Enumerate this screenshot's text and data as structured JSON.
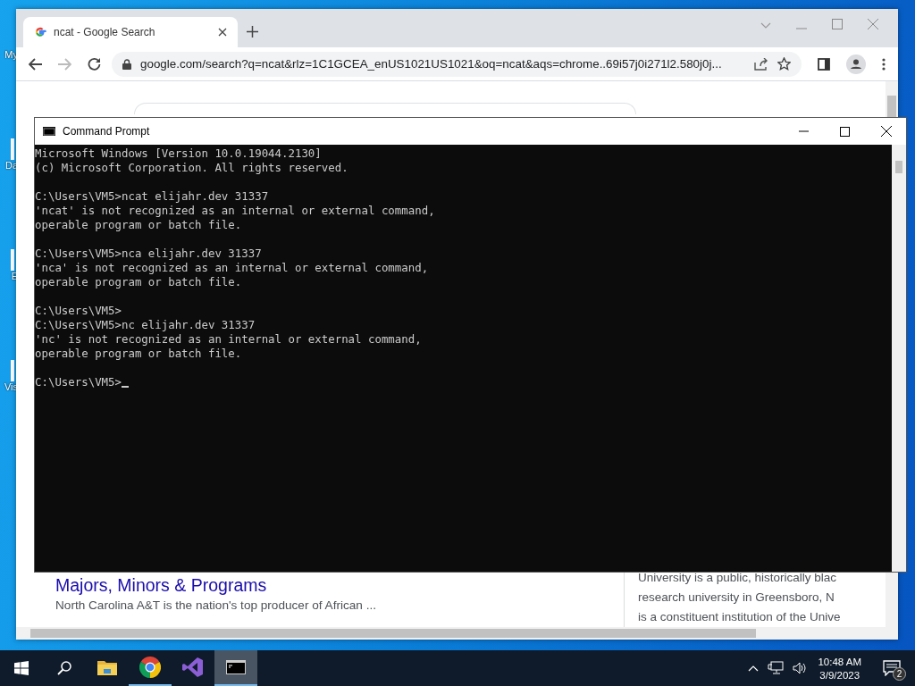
{
  "desktop": {
    "icons": [
      {
        "label": "My"
      },
      {
        "label": "Da"
      },
      {
        "label": "E"
      },
      {
        "label": "Vis"
      }
    ]
  },
  "browser": {
    "tab_title": "ncat - Google Search",
    "url": "google.com/search?q=ncat&rlz=1C1GCEA_enUS1021US1021&oq=ncat&aqs=chrome..69i57j0i271l2.580j0j...",
    "result": {
      "title": "Majors, Minors & Programs",
      "snippet": "North Carolina A&T is the nation's top producer of African ..."
    },
    "panel_lines": [
      "University is a public, historically blac",
      "research university in Greensboro, N",
      "is a constituent institution of the Unive"
    ]
  },
  "terminal": {
    "title": "Command Prompt",
    "blocks": [
      [
        "Microsoft Windows [Version 10.0.19044.2130]",
        "(c) Microsoft Corporation. All rights reserved."
      ],
      [
        "C:\\Users\\VM5>ncat elijahr.dev 31337",
        "'ncat' is not recognized as an internal or external command,",
        "operable program or batch file."
      ],
      [
        "C:\\Users\\VM5>nca elijahr.dev 31337",
        "'nca' is not recognized as an internal or external command,",
        "operable program or batch file."
      ],
      [
        "C:\\Users\\VM5>",
        "C:\\Users\\VM5>nc elijahr.dev 31337",
        "'nc' is not recognized as an internal or external command,",
        "operable program or batch file."
      ],
      [
        "C:\\Users\\VM5>"
      ]
    ],
    "cursor": true
  },
  "taskbar": {
    "apps": [
      {
        "kind": "explorer",
        "running": false,
        "selected": false
      },
      {
        "kind": "chrome",
        "running": true,
        "selected": false
      },
      {
        "kind": "studio",
        "running": false,
        "selected": false
      },
      {
        "kind": "terminal",
        "running": true,
        "selected": true
      }
    ],
    "time": "10:48 AM",
    "date": "3/9/2023",
    "notifications": "2"
  }
}
